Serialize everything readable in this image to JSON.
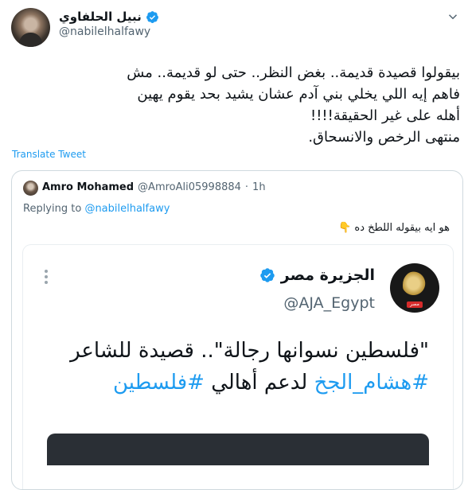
{
  "author": {
    "display_name": "نبيل الحلفاوي",
    "handle": "@nabilelhalfawy",
    "verified_icon": "verified-badge-icon",
    "accent_color": "#1d9bf0"
  },
  "tweet": {
    "text_line1": "بيقولوا قصيدة قديمة.. بغض النظر.. حتى لو قديمة.. مش",
    "text_line2": "فاهم إيه اللي يخلي بني آدم عشان يشيد بحد يقوم يهين",
    "text_line3": "أهله على غير الحقيقة!!!!",
    "text_line4": "منتهى الرخص والانسحاق.",
    "translate_label": "Translate Tweet"
  },
  "quote": {
    "name": "Amro Mohamed",
    "handle": "@AmroAli05998884",
    "separator": "·",
    "time": "1h",
    "replying_prefix": "Replying to",
    "replying_to": "@nabilelhalfawy",
    "text": "هو ايه بيقوله اللطخ ده",
    "text_emoji": "👇",
    "embed": {
      "account_name": "الجزيرة مصر",
      "account_handle": "@AJA_Egypt",
      "logo_tag": "مصر",
      "line1": "\"فلسطين نسوانها رجالة\".. قصيدة للشاعر",
      "hashtag1": "#هشام_الجخ",
      "middle": "لدعم أهالي",
      "hashtag2": "#فلسطين"
    }
  }
}
